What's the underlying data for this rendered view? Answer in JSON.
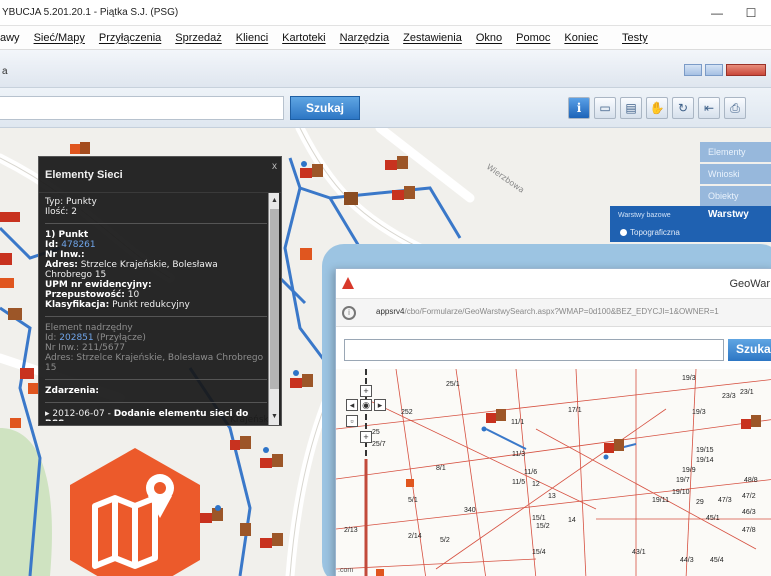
{
  "window": {
    "title": "YBUCJA 5.201.20.1 - Piątka S.J. (PSG)",
    "minimize_glyph": "—",
    "maximize_glyph": "☐"
  },
  "menu": [
    "awy",
    "Sieć/Mapy",
    "Przyłączenia",
    "Sprzedaż",
    "Klienci",
    "Kartoteki",
    "Narzędzia",
    "Zestawienia",
    "Okno",
    "Pomoc",
    "Koniec",
    "Testy"
  ],
  "strip": {
    "label": "a"
  },
  "toolbar": {
    "search_value": "",
    "search_button": "Szukaj",
    "tools": [
      "info-icon",
      "window-icon",
      "print-preview-icon",
      "hand-icon",
      "refresh-icon",
      "back-icon",
      "printer-icon"
    ]
  },
  "popup": {
    "title": "Elementy Sieci",
    "close": "x",
    "typ_label": "Typ:",
    "typ_value": "Punkty",
    "ilosc_label": "Ilość:",
    "ilosc_value": "2",
    "punkt_header": "1) Punkt",
    "id_label": "Id:",
    "id_value": "478261",
    "nr_label": "Nr Inw.:",
    "nr_value": "",
    "adres_label": "Adres:",
    "adres_value": "Strzelce Krajeńskie, Bolesława Chrobrego 15",
    "upm_label": "UPM nr ewidencyjny:",
    "przep_label": "Przepustowość:",
    "przep_value": "10",
    "klas_label": "Klasyfikacja:",
    "klas_value": "Punkt redukcyjny",
    "parent_header": "Element nadrzędny",
    "parent_id_label": "Id:",
    "parent_id_value": "202851",
    "parent_id_suffix": "(Przyłącze)",
    "parent_nr_label": "Nr Inw.:",
    "parent_nr_value": "211/5677",
    "parent_adres_label": "Adres:",
    "parent_adres_value": "Strzelce Krajeńskie, Bolesława Chrobrego 15",
    "zdarzenia_label": "Zdarzenia:",
    "event_date": "2012-06-07",
    "event_text": "Dodanie elementu sieci do RSS"
  },
  "layers_panel": {
    "tabs": [
      "Elementy",
      "Wnioski",
      "Obiekty"
    ],
    "heading_small": "Warstwy bazowe",
    "heading": "Warstwy",
    "option": "Topograficzna"
  },
  "map_labels": {
    "street": "Strzelce Krajeńskie",
    "street2": "Wierzbowa"
  },
  "window2": {
    "title": "GeoWar",
    "url_prefix": "appsrv4",
    "url_rest": "/cbo/Formularze/GeoWarstwySearch.aspx?WMAP=0d100&BEZ_EDYCJI=1&OWNER=1",
    "search_value": "",
    "search_button": "Szuka",
    "parcels": [
      "19/3",
      "23/3",
      "23/1",
      "252",
      "17/1",
      "19/3",
      "11/1",
      "11/3",
      "19/15",
      "19/14",
      "19/9",
      "8/1",
      "11/6",
      "11/5",
      "12",
      "19/7",
      "48/8",
      "47/2",
      "13",
      "19/10",
      "19/11",
      "29",
      "5/1",
      "340",
      "15/1",
      "15/2",
      "14",
      "45/1",
      "46/3",
      "47/3",
      "47/8",
      "2/13",
      "2/14",
      "5/2",
      "15/4",
      "43/1",
      "44/3",
      "45/4",
      "25/1",
      "25",
      "25/7"
    ],
    "corner_text": ".com"
  },
  "colors": {
    "accent_blue": "#2d76c4",
    "pipe_blue": "#3a78c9",
    "parcel_red": "#d65040",
    "icon_orange": "#ec5a2b"
  }
}
